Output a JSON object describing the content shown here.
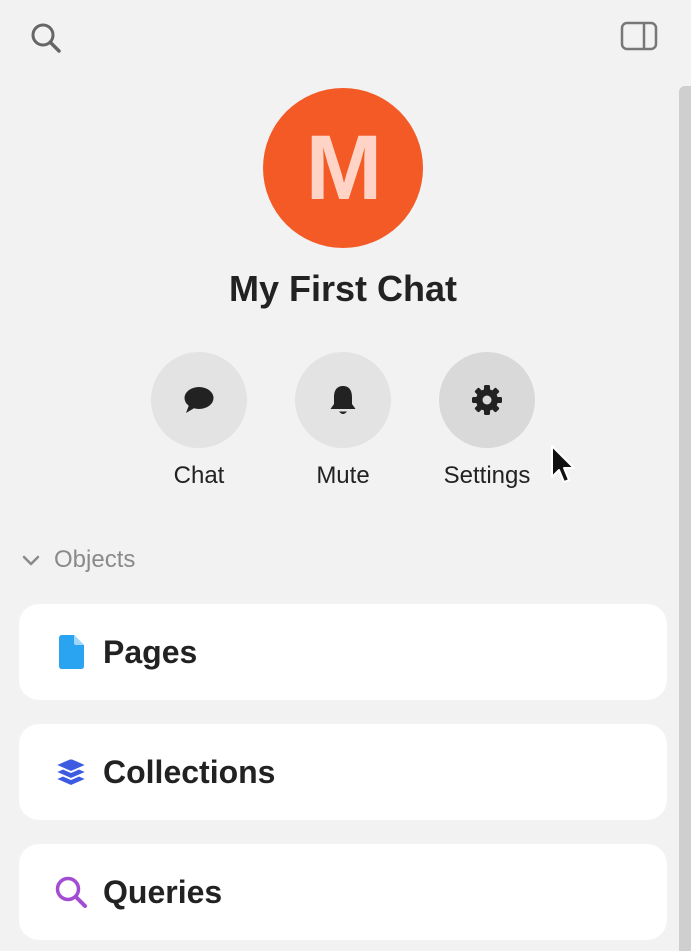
{
  "header": {
    "search_icon": "search-icon",
    "panel_icon": "sidebar-panel-icon"
  },
  "profile": {
    "avatar_letter": "M",
    "avatar_color": "#f45a26",
    "avatar_text_color": "#ffd4c6",
    "title": "My First Chat"
  },
  "actions": [
    {
      "label": "Chat",
      "icon": "speech-bubble-icon"
    },
    {
      "label": "Mute",
      "icon": "bell-icon"
    },
    {
      "label": "Settings",
      "icon": "gear-icon"
    }
  ],
  "objects": {
    "section_label": "Objects",
    "expanded": true,
    "items": [
      {
        "label": "Pages",
        "icon": "page-icon",
        "icon_color": "#2aa3f0"
      },
      {
        "label": "Collections",
        "icon": "layers-icon",
        "icon_color": "#3d5be0"
      },
      {
        "label": "Queries",
        "icon": "search-icon",
        "icon_color": "#a24bd3"
      }
    ]
  }
}
